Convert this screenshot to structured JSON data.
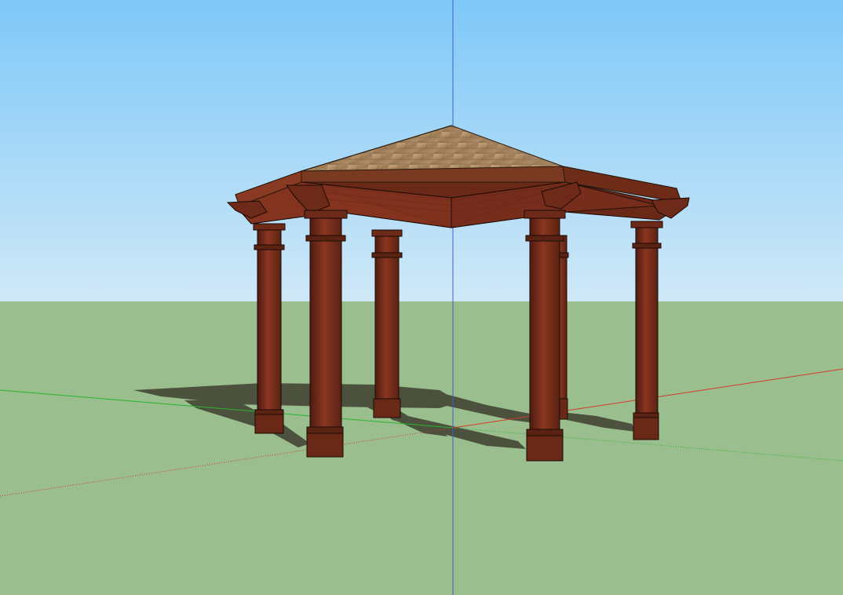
{
  "viewport": {
    "sky_top_color": "#7ec8f8",
    "sky_bottom_color": "#cfe8f7",
    "ground_color": "#9bbe8e"
  },
  "axes": {
    "red_axis_color": "#d23a2a",
    "green_axis_color": "#27b531",
    "blue_axis_color": "#3f5fd0"
  },
  "model": {
    "name": "hexagonal-gazebo",
    "post_count": 6,
    "wood_color": "#7a2f1e",
    "wood_dark_color": "#4e1b10",
    "wood_light_color": "#a14a31",
    "roof_color": "#b08f6a",
    "shadow_color": "#3a3a2c"
  }
}
